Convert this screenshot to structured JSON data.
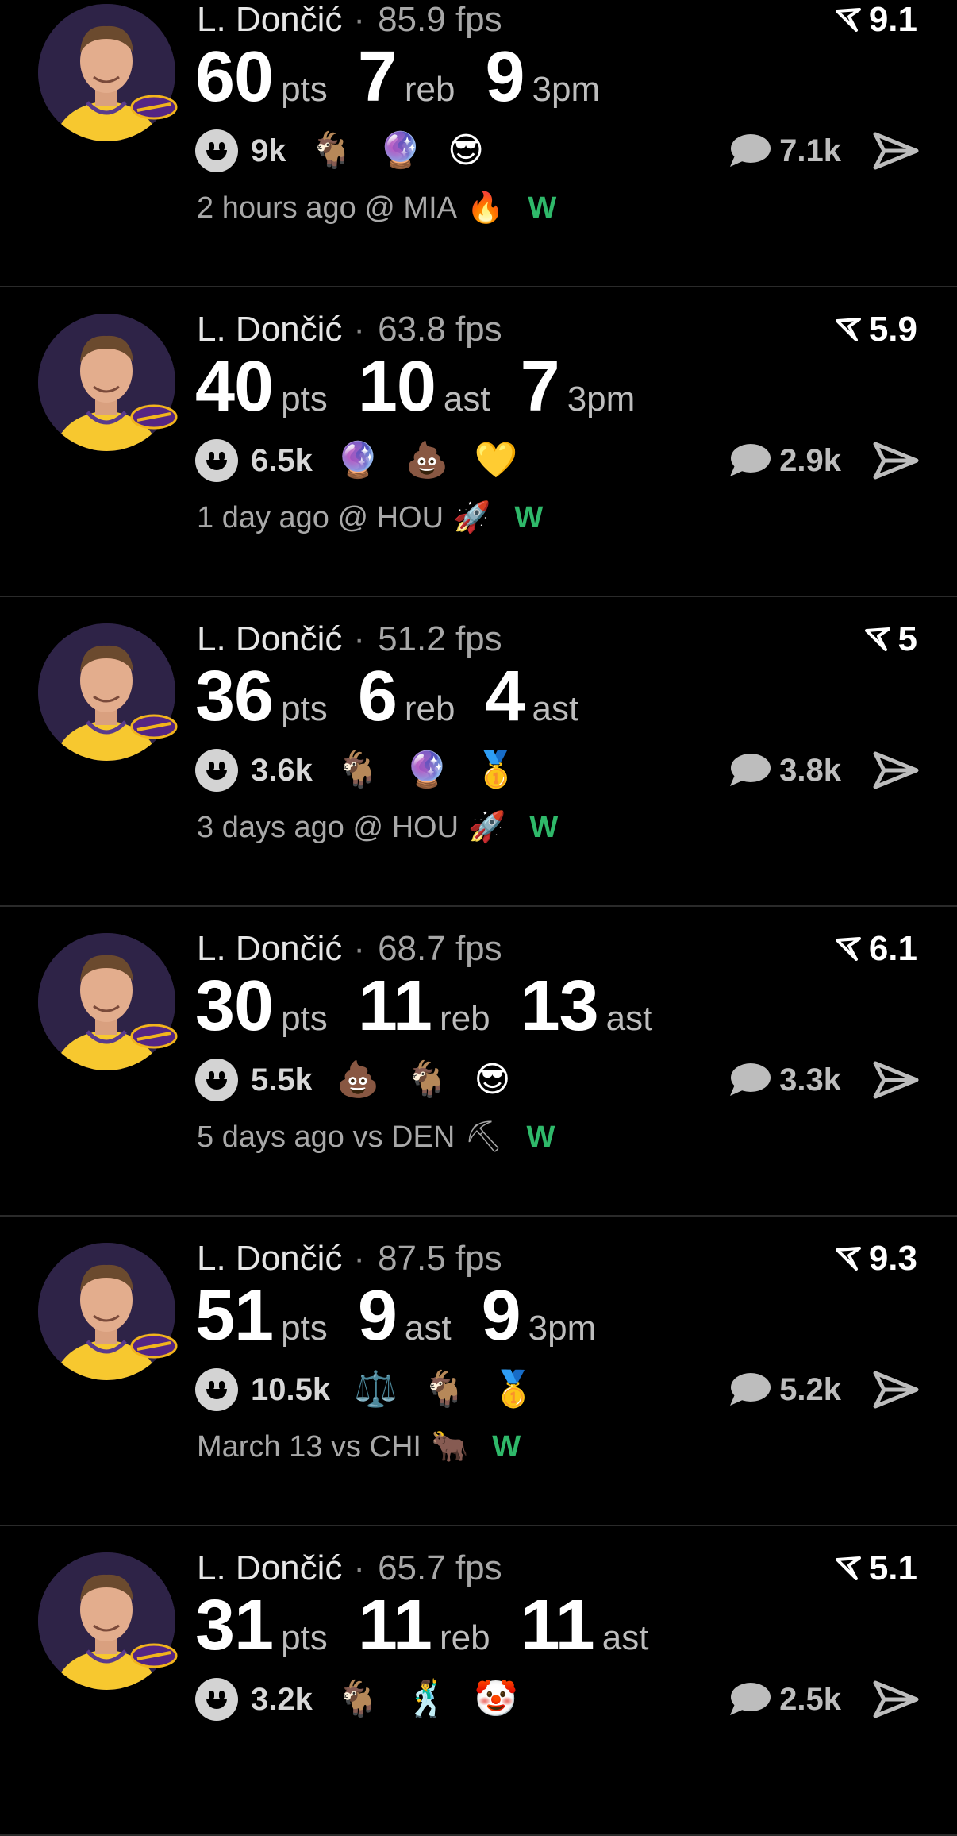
{
  "colors": {
    "background": "#000000",
    "win": "#2fb96a",
    "avatar_bg": "#2e2347"
  },
  "posts": [
    {
      "player": "L. Dončić",
      "fps": "85.9 fps",
      "rating": "9.1",
      "stats": [
        {
          "num": "60",
          "lbl": "pts"
        },
        {
          "num": "7",
          "lbl": "reb"
        },
        {
          "num": "9",
          "lbl": "3pm"
        }
      ],
      "likes": "9k",
      "emojis": [
        "🐐",
        "🔮",
        "😎"
      ],
      "comments": "7.1k",
      "when": "2 hours ago",
      "vs": "@ MIA",
      "team_icon": "🔥",
      "result": "W"
    },
    {
      "player": "L. Dončić",
      "fps": "63.8 fps",
      "rating": "5.9",
      "stats": [
        {
          "num": "40",
          "lbl": "pts"
        },
        {
          "num": "10",
          "lbl": "ast"
        },
        {
          "num": "7",
          "lbl": "3pm"
        }
      ],
      "likes": "6.5k",
      "emojis": [
        "🔮",
        "💩",
        "💛"
      ],
      "comments": "2.9k",
      "when": "1 day ago",
      "vs": "@ HOU",
      "team_icon": "🚀",
      "result": "W"
    },
    {
      "player": "L. Dončić",
      "fps": "51.2 fps",
      "rating": "5",
      "stats": [
        {
          "num": "36",
          "lbl": "pts"
        },
        {
          "num": "6",
          "lbl": "reb"
        },
        {
          "num": "4",
          "lbl": "ast"
        }
      ],
      "likes": "3.6k",
      "emojis": [
        "🐐",
        "🔮",
        "🥇"
      ],
      "comments": "3.8k",
      "when": "3 days ago",
      "vs": "@ HOU",
      "team_icon": "🚀",
      "result": "W"
    },
    {
      "player": "L. Dončić",
      "fps": "68.7 fps",
      "rating": "6.1",
      "stats": [
        {
          "num": "30",
          "lbl": "pts"
        },
        {
          "num": "11",
          "lbl": "reb"
        },
        {
          "num": "13",
          "lbl": "ast"
        }
      ],
      "likes": "5.5k",
      "emojis": [
        "💩",
        "🐐",
        "😎"
      ],
      "comments": "3.3k",
      "when": "5 days ago",
      "vs": "vs DEN",
      "team_icon": "⛏",
      "result": "W"
    },
    {
      "player": "L. Dončić",
      "fps": "87.5 fps",
      "rating": "9.3",
      "stats": [
        {
          "num": "51",
          "lbl": "pts"
        },
        {
          "num": "9",
          "lbl": "ast"
        },
        {
          "num": "9",
          "lbl": "3pm"
        }
      ],
      "likes": "10.5k",
      "emojis": [
        "⚖️",
        "🐐",
        "🥇"
      ],
      "comments": "5.2k",
      "when": "March 13",
      "vs": "vs CHI",
      "team_icon": "🐂",
      "result": "W"
    },
    {
      "player": "L. Dončić",
      "fps": "65.7 fps",
      "rating": "5.1",
      "stats": [
        {
          "num": "31",
          "lbl": "pts"
        },
        {
          "num": "11",
          "lbl": "reb"
        },
        {
          "num": "11",
          "lbl": "ast"
        }
      ],
      "likes": "3.2k",
      "emojis": [
        "🐐",
        "🕺",
        "🤡"
      ],
      "comments": "2.5k",
      "when": "",
      "vs": "",
      "team_icon": "",
      "result": ""
    }
  ]
}
